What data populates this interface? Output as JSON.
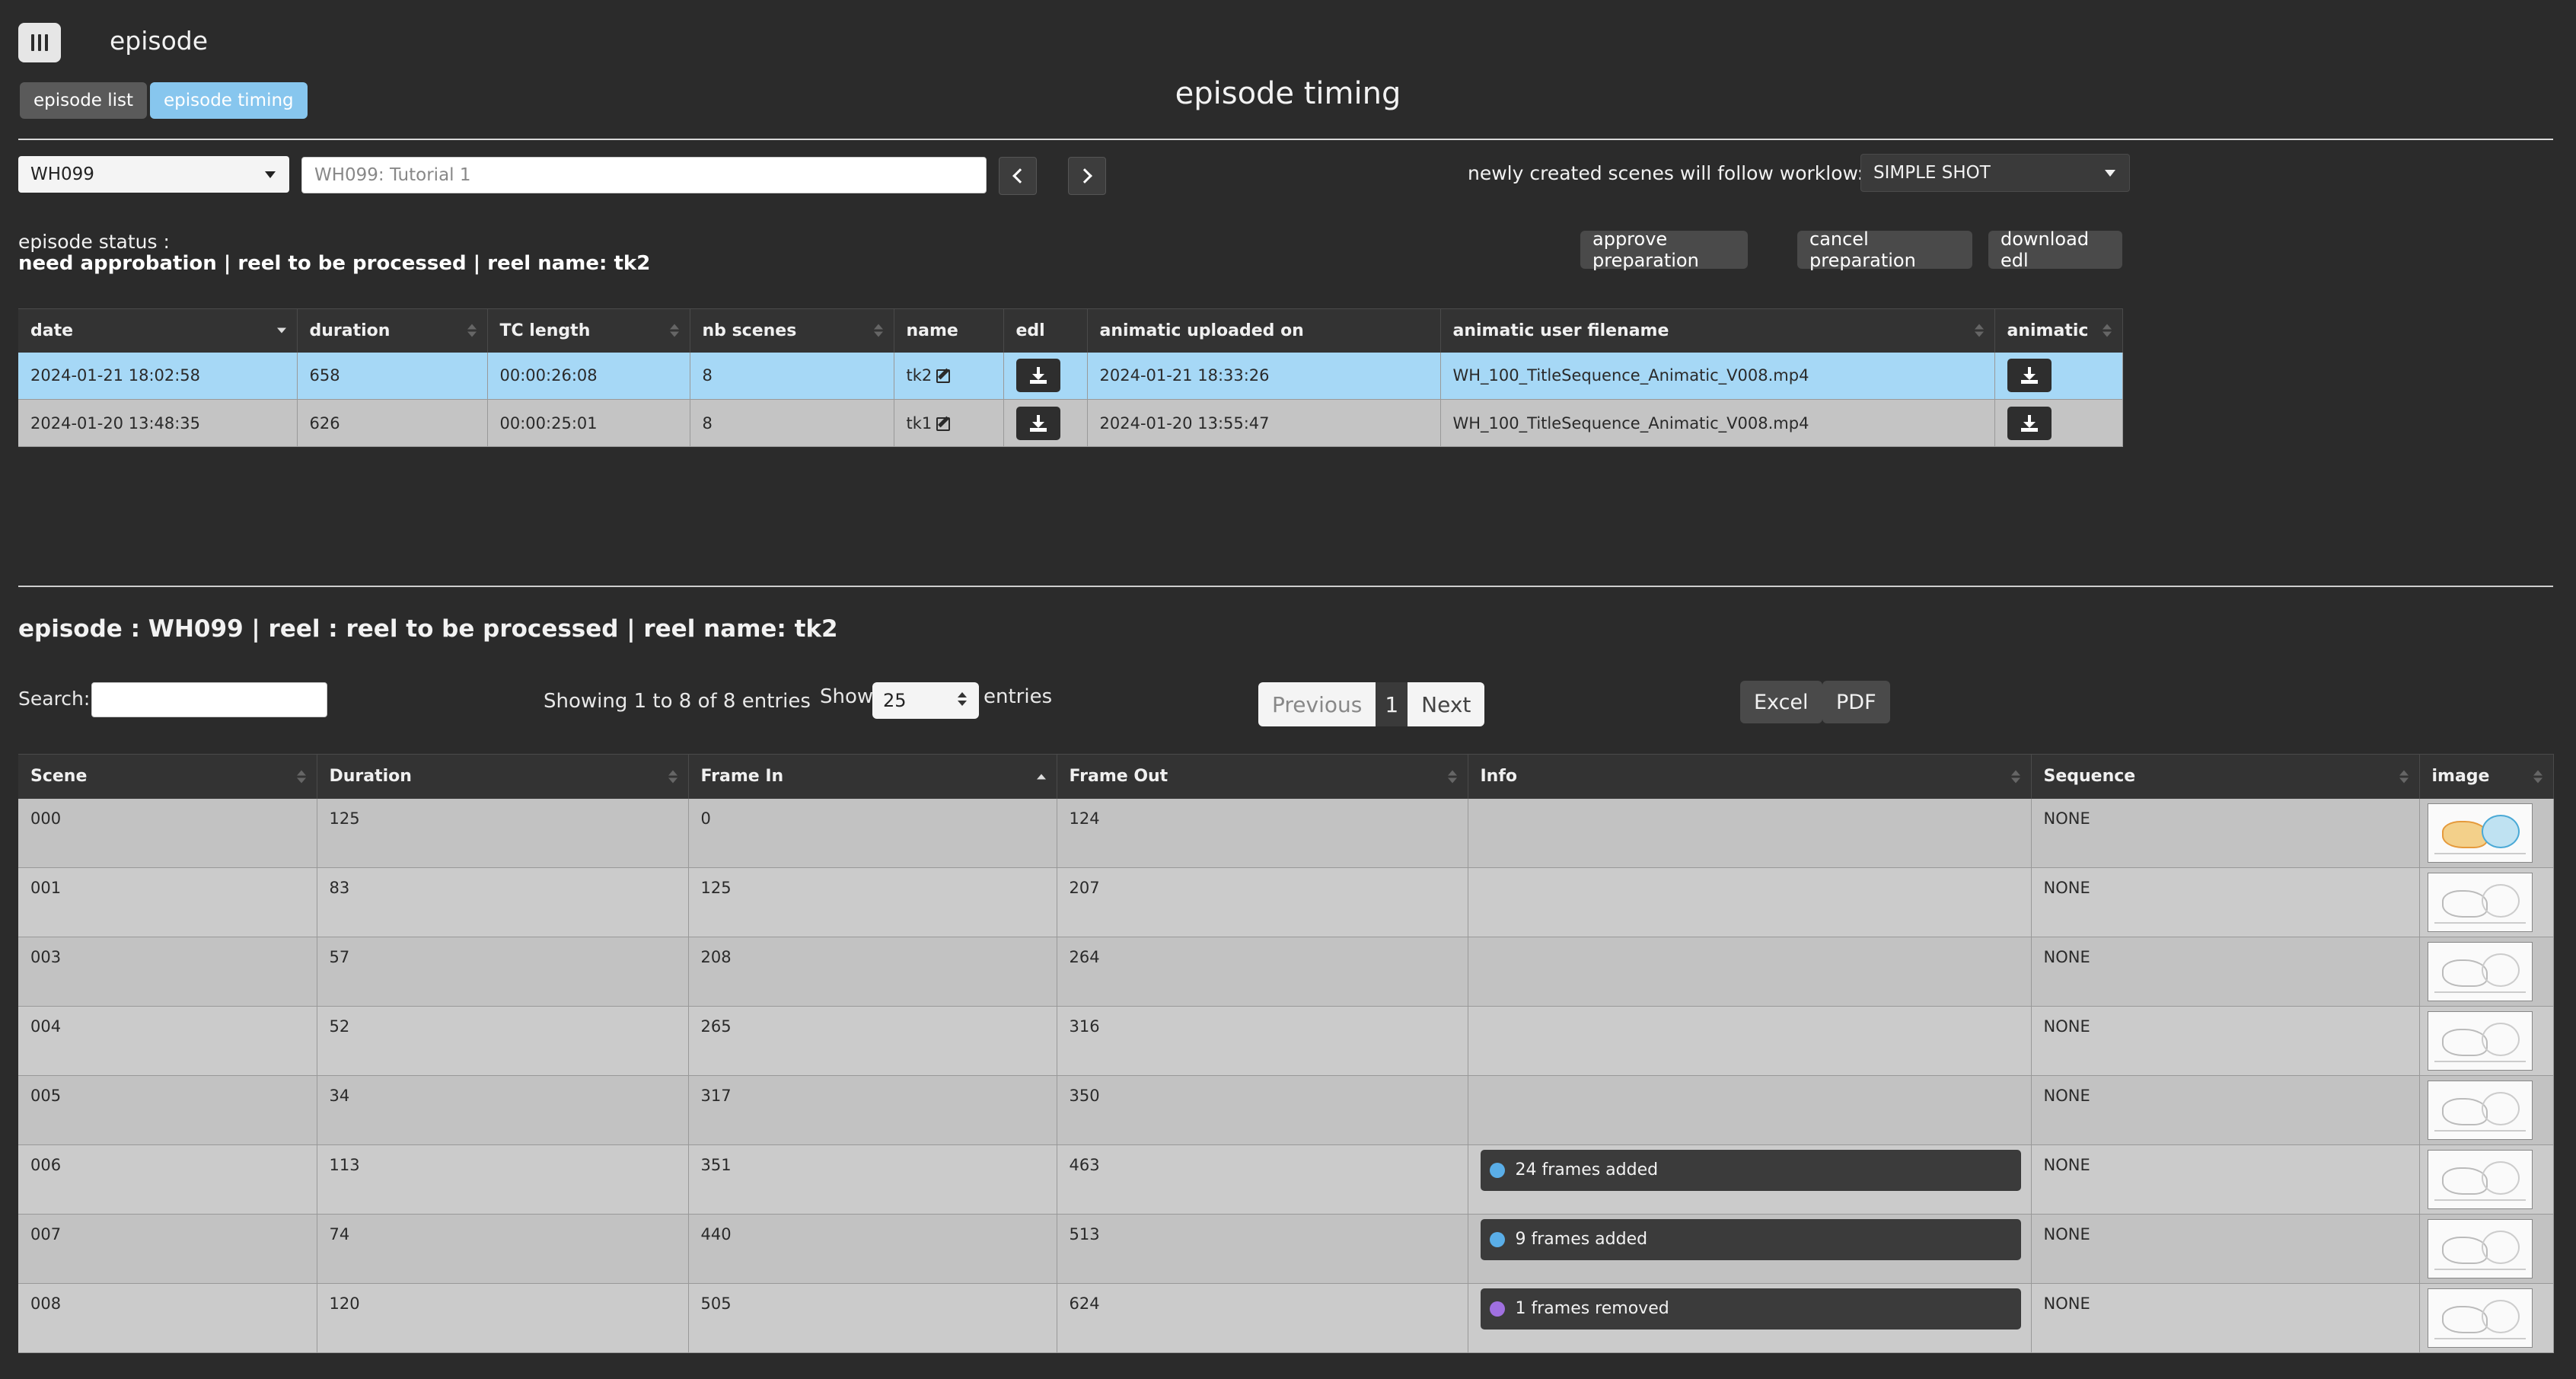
{
  "header": {
    "app_title": "episode",
    "page_title": "episode timing",
    "tabs": [
      {
        "label": "episode list",
        "active": false
      },
      {
        "label": "episode timing",
        "active": true
      }
    ],
    "menu_icon": "menu-bars-icon"
  },
  "controls": {
    "episode_select": "WH099",
    "episode_name_value": "WH099: Tutorial 1",
    "workflow_label": "newly created scenes will follow worklow:",
    "workflow_select": "SIMPLE SHOT"
  },
  "status": {
    "label": "episode status :",
    "value": "need approbation | reel to be processed | reel name: tk2"
  },
  "actions": {
    "approve": "approve preparation",
    "cancel": "cancel preparation",
    "download_edl": "download edl"
  },
  "reel_table": {
    "columns": [
      "date",
      "duration",
      "TC length",
      "nb scenes",
      "name",
      "edl",
      "animatic uploaded on",
      "animatic user filename",
      "animatic"
    ],
    "rows": [
      {
        "date": "2024-01-21 18:02:58",
        "duration": "658",
        "tc": "00:00:26:08",
        "scenes": "8",
        "name": "tk2",
        "uploaded": "2024-01-21 18:33:26",
        "filename": "WH_100_TitleSequence_Animatic_V008.mp4"
      },
      {
        "date": "2024-01-20 13:48:35",
        "duration": "626",
        "tc": "00:00:25:01",
        "scenes": "8",
        "name": "tk1",
        "uploaded": "2024-01-20 13:55:47",
        "filename": "WH_100_TitleSequence_Animatic_V008.mp4"
      }
    ]
  },
  "episode_heading": "episode : WH099 | reel : reel to be processed | reel name: tk2",
  "datatable": {
    "search_label": "Search:",
    "showing": "Showing 1 to 8 of 8 entries",
    "show_label": "Show",
    "page_length": "25",
    "entries_label": "entries",
    "previous": "Previous",
    "page": "1",
    "next": "Next",
    "excel": "Excel",
    "pdf": "PDF"
  },
  "scene_table": {
    "columns": [
      "Scene",
      "Duration",
      "Frame In",
      "Frame Out",
      "Info",
      "Sequence",
      "image"
    ],
    "rows": [
      {
        "scene": "000",
        "duration": "125",
        "frame_in": "0",
        "frame_out": "124",
        "info": "",
        "info_color": "",
        "sequence": "NONE"
      },
      {
        "scene": "001",
        "duration": "83",
        "frame_in": "125",
        "frame_out": "207",
        "info": "",
        "info_color": "",
        "sequence": "NONE"
      },
      {
        "scene": "003",
        "duration": "57",
        "frame_in": "208",
        "frame_out": "264",
        "info": "",
        "info_color": "",
        "sequence": "NONE"
      },
      {
        "scene": "004",
        "duration": "52",
        "frame_in": "265",
        "frame_out": "316",
        "info": "",
        "info_color": "",
        "sequence": "NONE"
      },
      {
        "scene": "005",
        "duration": "34",
        "frame_in": "317",
        "frame_out": "350",
        "info": "",
        "info_color": "",
        "sequence": "NONE"
      },
      {
        "scene": "006",
        "duration": "113",
        "frame_in": "351",
        "frame_out": "463",
        "info": "24 frames added",
        "info_color": "#5aaee8",
        "sequence": "NONE"
      },
      {
        "scene": "007",
        "duration": "74",
        "frame_in": "440",
        "frame_out": "513",
        "info": "9 frames added",
        "info_color": "#5aaee8",
        "sequence": "NONE"
      },
      {
        "scene": "008",
        "duration": "120",
        "frame_in": "505",
        "frame_out": "624",
        "info": "1 frames removed",
        "info_color": "#a070e0",
        "sequence": "NONE"
      }
    ]
  },
  "colors": {
    "background": "#2b2b2b",
    "accent": "#87c6ee",
    "selected_row": "#a6d8f6"
  }
}
